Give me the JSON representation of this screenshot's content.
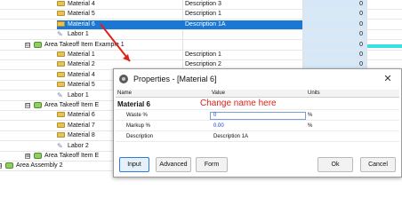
{
  "tree": {
    "rows": [
      {
        "kind": "material",
        "indent": 2,
        "name": "Material 4",
        "desc": "Description 3",
        "num": "0"
      },
      {
        "kind": "material",
        "indent": 2,
        "name": "Material 5",
        "desc": "Description 1",
        "num": "0"
      },
      {
        "kind": "material",
        "indent": 2,
        "name": "Material 6",
        "desc": "Description 1A",
        "num": "0",
        "selected": true
      },
      {
        "kind": "labor",
        "indent": 2,
        "name": "Labor 1",
        "desc": "",
        "num": "0"
      },
      {
        "kind": "area",
        "indent": 1,
        "name": "Area Takeoff Item Example 1",
        "desc": "",
        "num": "0",
        "expander": "⊟"
      },
      {
        "kind": "material",
        "indent": 2,
        "name": "Material 1",
        "desc": "Description 1",
        "num": "0"
      },
      {
        "kind": "material",
        "indent": 2,
        "name": "Material 2",
        "desc": "Description 2",
        "num": "0"
      },
      {
        "kind": "material",
        "indent": 2,
        "name": "Material 4",
        "desc": "",
        "num": ""
      },
      {
        "kind": "material",
        "indent": 2,
        "name": "Material 5",
        "desc": "",
        "num": ""
      },
      {
        "kind": "labor",
        "indent": 2,
        "name": "Labor 1",
        "desc": "",
        "num": ""
      },
      {
        "kind": "area",
        "indent": 1,
        "name": "Area Takeoff Item E",
        "desc": "",
        "num": "",
        "expander": "⊟"
      },
      {
        "kind": "material",
        "indent": 2,
        "name": "Material 6",
        "desc": "",
        "num": ""
      },
      {
        "kind": "material",
        "indent": 2,
        "name": "Material 7",
        "desc": "",
        "num": ""
      },
      {
        "kind": "material",
        "indent": 2,
        "name": "Material 8",
        "desc": "",
        "num": ""
      },
      {
        "kind": "labor",
        "indent": 2,
        "name": "Labor 2",
        "desc": "",
        "num": ""
      },
      {
        "kind": "area",
        "indent": 1,
        "name": "Area Takeoff Item E",
        "desc": "",
        "num": "",
        "expander": "⊞"
      },
      {
        "kind": "assembly",
        "indent": 0,
        "name": "Area Assembly 2",
        "desc": "",
        "num": "",
        "expander": "⊞"
      }
    ]
  },
  "dialog": {
    "title": "Properties - [Material 6]",
    "close": "✕",
    "columns": {
      "name": "Name",
      "value": "Value",
      "units": "Units"
    },
    "rows": [
      {
        "name": "Material 6",
        "value": "",
        "units": "",
        "header": true
      },
      {
        "name": "Waste %",
        "value": "0",
        "units": "%"
      },
      {
        "name": "Markup %",
        "value": "0.00",
        "units": "%"
      },
      {
        "name": "Description",
        "value": "Description 1A",
        "units": ""
      }
    ],
    "buttons": {
      "input": "Input",
      "advanced": "Advanced",
      "form": "Form",
      "ok": "Ok",
      "cancel": "Cancel"
    }
  },
  "annotation": {
    "text": "Change name here",
    "color": "#e0201a"
  },
  "colors": {
    "selection": "#1a78d4",
    "number_column": "#d6e7f7",
    "accent_bar": "#38e0e6"
  }
}
